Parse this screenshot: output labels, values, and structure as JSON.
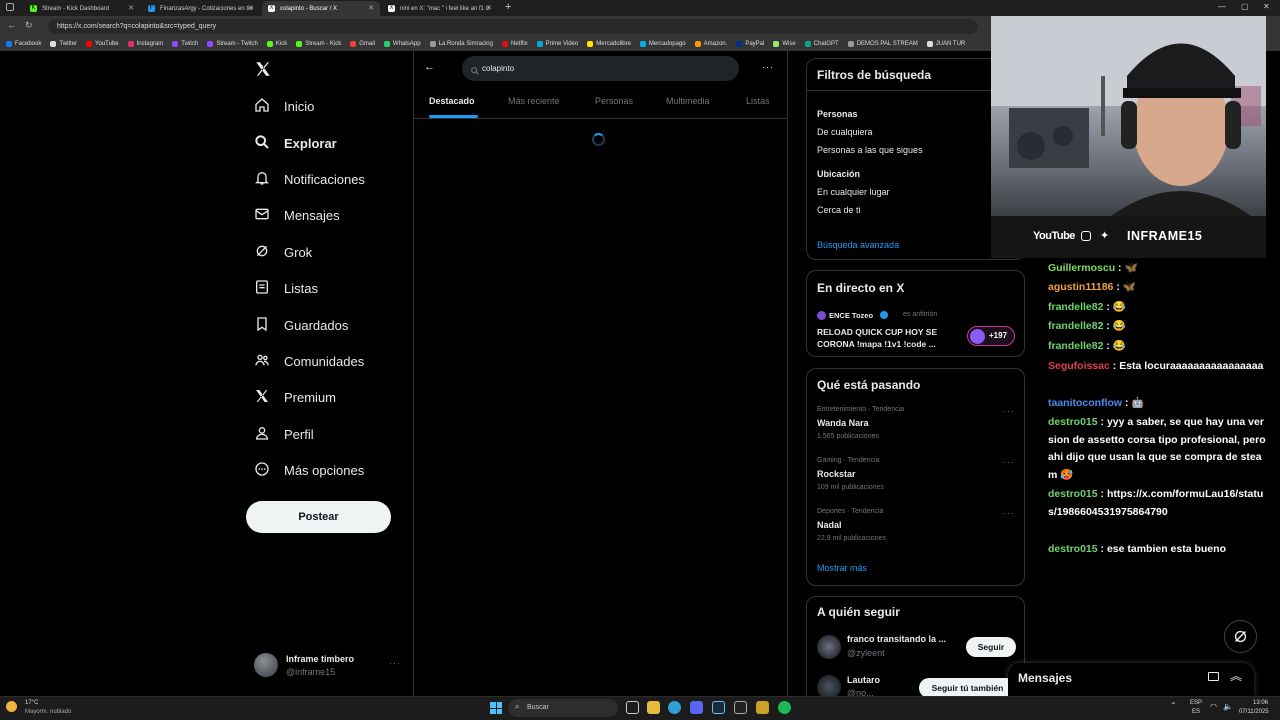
{
  "browser": {
    "tabs": [
      {
        "label": "Stream - Kick Dashboard",
        "fav": "K",
        "color": "#53fc18"
      },
      {
        "label": "FinanzasArgy - Cotizaciones en tie",
        "fav": "F",
        "color": "#1d9bf0"
      },
      {
        "label": "colapinto - Buscar / X",
        "fav": "X",
        "color": "#ffffff"
      },
      {
        "label": "nini en X: \"mac \" i feel like an f1 d",
        "fav": "X",
        "color": "#ffffff"
      }
    ],
    "new_tab": "+",
    "url": "https://x.com/search?q=colapinto&src=typed_query",
    "bookmarks": [
      "Facebook",
      "Twitter",
      "YouTube",
      "Instagram",
      "Twitch",
      "Stream - Twitch",
      "Kick",
      "Stream - Kick",
      "Gmail",
      "WhatsApp",
      "La Ronda Simracing",
      "Netflix",
      "Prime Video",
      "Mercadolibre",
      "Mercadopago",
      "Amazon.",
      "PayPal",
      "Wise",
      "ChatGPT",
      "DEMOS PAL STREAM",
      "JUAN TUR"
    ]
  },
  "nav": {
    "items": [
      {
        "label": "Inicio",
        "icon": "home-icon"
      },
      {
        "label": "Explorar",
        "icon": "search-icon"
      },
      {
        "label": "Notificaciones",
        "icon": "bell-icon"
      },
      {
        "label": "Mensajes",
        "icon": "mail-icon"
      },
      {
        "label": "Grok",
        "icon": "grok-icon"
      },
      {
        "label": "Listas",
        "icon": "list-icon"
      },
      {
        "label": "Guardados",
        "icon": "bookmark-icon"
      },
      {
        "label": "Comunidades",
        "icon": "people-icon"
      },
      {
        "label": "Premium",
        "icon": "x-logo-icon"
      },
      {
        "label": "Perfil",
        "icon": "person-icon"
      },
      {
        "label": "Más opciones",
        "icon": "more-circle-icon"
      }
    ],
    "post_label": "Postear",
    "account": {
      "name": "Inframe timbero",
      "handle": "@inframe15"
    }
  },
  "search": {
    "query": "colapinto",
    "tabs": [
      "Destacado",
      "Más reciente",
      "Personas",
      "Multimedia",
      "Listas"
    ],
    "active_tab": "Destacado"
  },
  "filters": {
    "title": "Filtros de búsqueda",
    "people_heading": "Personas",
    "people_options": [
      "De cualquiera",
      "Personas a las que sigues"
    ],
    "location_heading": "Ubicación",
    "location_options": [
      "En cualquier lugar",
      "Cerca de ti"
    ],
    "advanced": "Búsqueda avanzada"
  },
  "live": {
    "title": "En directo en X",
    "host": "ENCE Tozeo",
    "host_suffix": "es anfitrión",
    "text": "RELOAD QUICK CUP HOY SE CORONA !mapa !1v1 !code ...",
    "listeners": "+197"
  },
  "trends": {
    "title": "Qué está pasando",
    "items": [
      {
        "context": "Entretenimiento · Tendencia",
        "name": "Wanda Nara",
        "count": "1.565 publicaciones"
      },
      {
        "context": "Gaming · Tendencia",
        "name": "Rockstar",
        "count": "109 mil publicaciones"
      },
      {
        "context": "Deportes · Tendencia",
        "name": "Nadal",
        "count": "22,9 mil publicaciones"
      }
    ],
    "show_more": "Mostrar más"
  },
  "follow": {
    "title": "A quién seguir",
    "items": [
      {
        "name": "franco transitando la ...",
        "handle": "@zyleent",
        "button": "Seguir"
      },
      {
        "name": "Lautaro",
        "handle": "@no...",
        "button": "Seguir tú también"
      }
    ]
  },
  "messages_drawer": {
    "title": "Mensajes"
  },
  "stream_overlay": {
    "socials": [
      "YouTube",
      "INFRAME15"
    ]
  },
  "chat": [
    {
      "user": "Guillermoscu",
      "color": "#7cdc5a",
      "text": " : 🦋"
    },
    {
      "user": "agustin11186",
      "color": "#f0a23a",
      "text": " : 🦋"
    },
    {
      "user": "frandelle82",
      "color": "#6fd36b",
      "text": " : 😂"
    },
    {
      "user": "frandelle82",
      "color": "#6fd36b",
      "text": " : 😂"
    },
    {
      "user": "frandelle82",
      "color": "#6fd36b",
      "text": " : 😂"
    },
    {
      "user": "Segufoissac",
      "color": "#e0404f",
      "text": " : Esta locuraaaaaaaaaaaaaaaa"
    },
    {
      "user": "taanitoconflow",
      "color": "#4a8cf0",
      "text": " : 🤖"
    },
    {
      "user": "destro015",
      "color": "#6fd36b",
      "text": " : yyy a saber, se que hay una version de assetto corsa tipo profesional, pero ahi dijo que usan la que se compra de steam 🥵"
    },
    {
      "user": "destro015",
      "color": "#6fd36b",
      "text": " : https://x.com/formuLau16/status/1986604531975864790"
    },
    {
      "user": "destro015",
      "color": "#6fd36b",
      "text": " : ese tambien esta bueno"
    }
  ],
  "taskbar": {
    "weather_temp": "17°C",
    "weather_desc": "Mayorm. nublado",
    "search": "Buscar",
    "lang": "ESP",
    "region": "ES",
    "time": "13:06",
    "date": "07/11/2025"
  }
}
